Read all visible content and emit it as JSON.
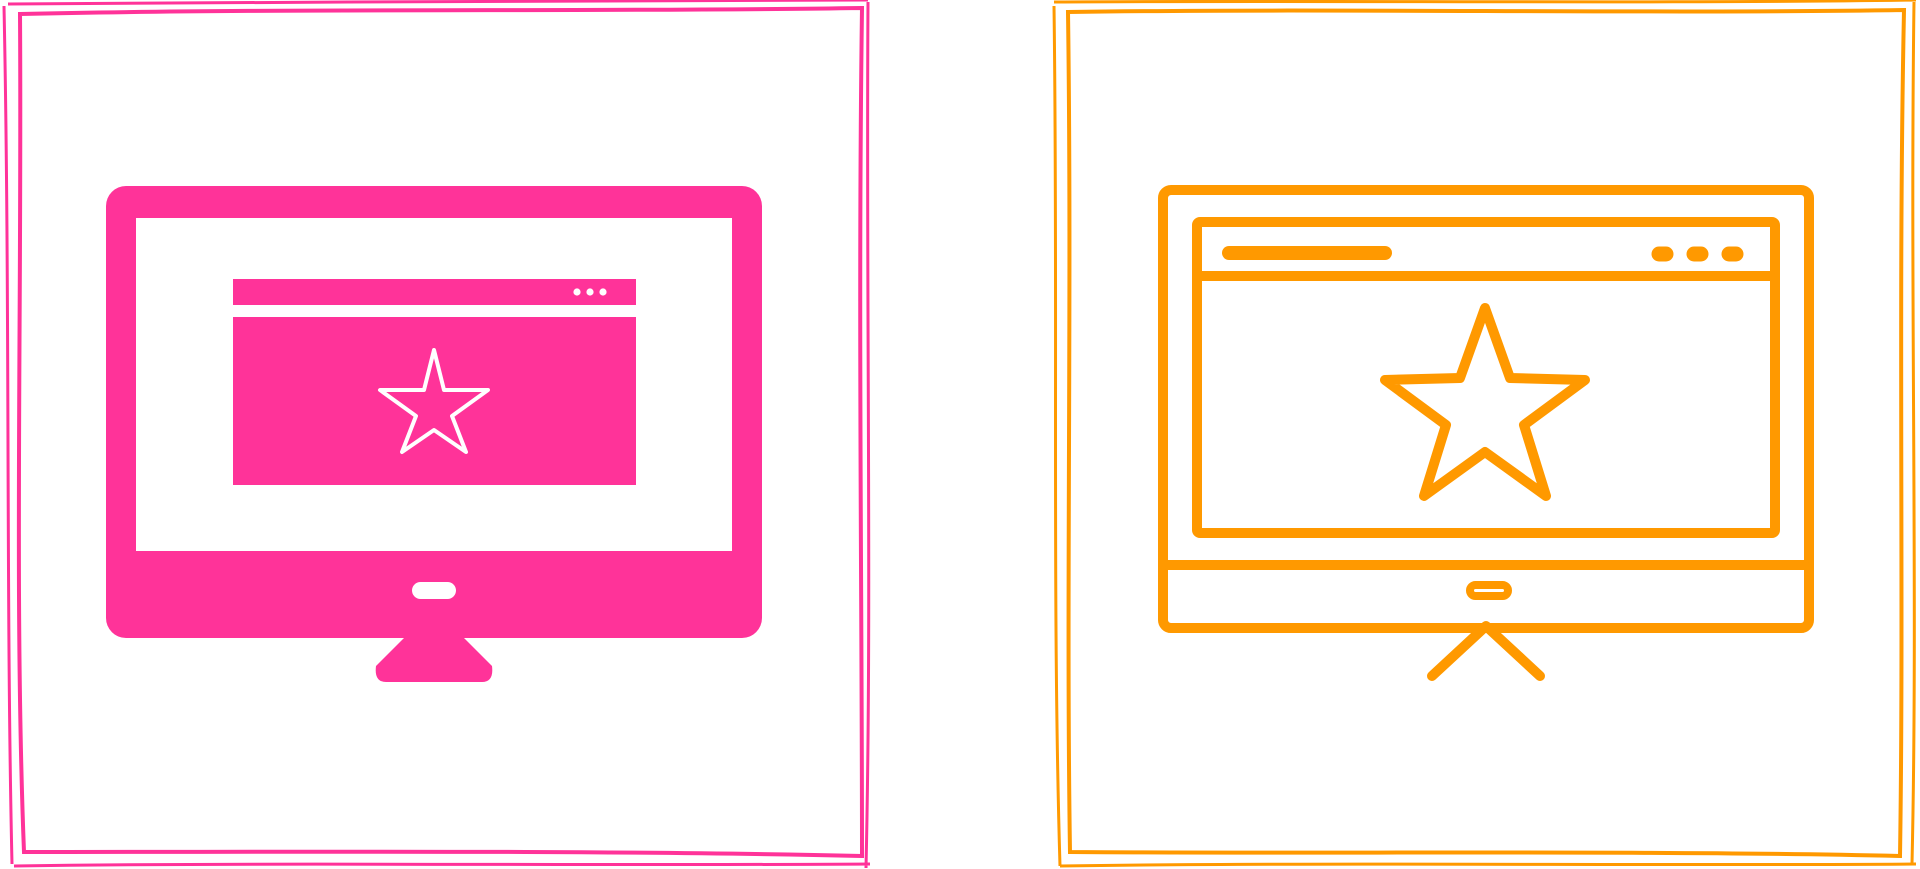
{
  "icons": [
    {
      "name": "favorite-website-monitor-icon",
      "style": "glyph",
      "color": "#FF3399"
    },
    {
      "name": "favorite-website-monitor-icon",
      "style": "outline",
      "color": "#FF9900"
    }
  ]
}
